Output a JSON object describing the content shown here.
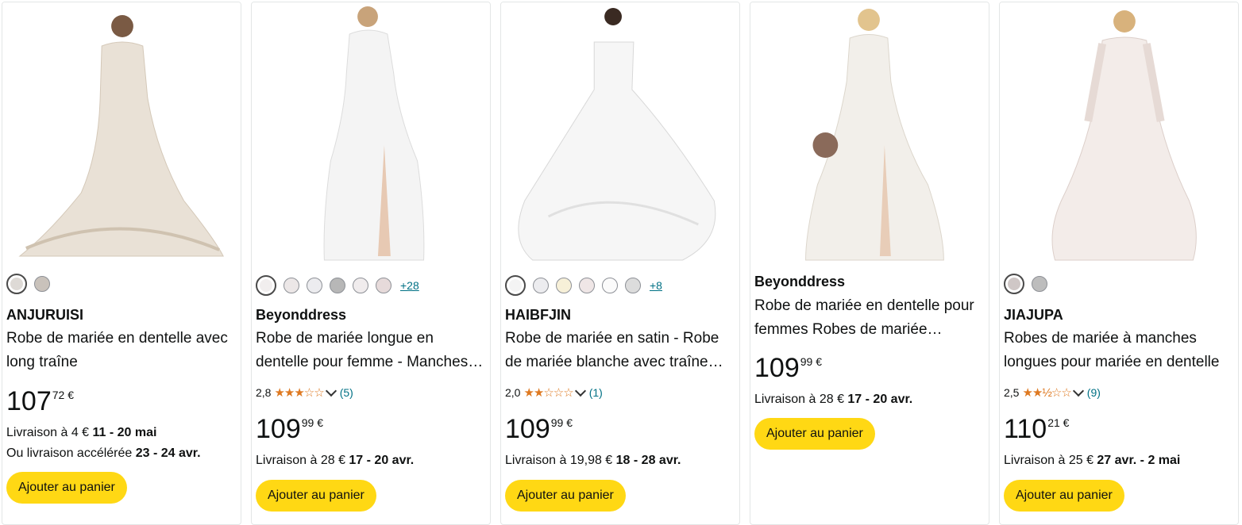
{
  "products": [
    {
      "brand": "ANJURUISI",
      "title": "Robe de mariée en dentelle avec long traîne",
      "price_whole": "107",
      "price_frac": "72 €",
      "delivery_prefix": "Livraison à 4 € ",
      "delivery_date": "11 - 20 mai",
      "delivery2_prefix": "Ou livraison accélérée ",
      "delivery2_date": "23 - 24 avr.",
      "button": "Ajouter au panier",
      "swatch_colors": [
        "#dedad6",
        "#c9c2bb"
      ]
    },
    {
      "brand": "Beyonddress",
      "title": "Robe de mariée longue en dentelle pour femme - Manches courtes",
      "rating_value": "2,8",
      "rating_stars": "★★★☆☆",
      "rating_count": "(5)",
      "price_whole": "109",
      "price_frac": "99 €",
      "delivery_prefix": "Livraison à 28 € ",
      "delivery_date": "17 - 20 avr.",
      "button": "Ajouter au panier",
      "swatch_colors": [
        "#f1eeee",
        "#ece7e7",
        "#ececef",
        "#b7b7b7",
        "#f0eced",
        "#e6dada"
      ],
      "more": "+28"
    },
    {
      "brand": "HAIBFJIN",
      "title": "Robe de mariée en satin - Robe de mariée blanche avec traîne longue",
      "rating_value": "2,0",
      "rating_stars": "★★☆☆☆",
      "rating_count": "(1)",
      "price_whole": "109",
      "price_frac": "99 €",
      "delivery_prefix": "Livraison à 19,98 € ",
      "delivery_date": "18 - 28 avr.",
      "button": "Ajouter au panier",
      "swatch_colors": [
        "#f4f4f4",
        "#ececef",
        "#f7f0d8",
        "#efe6e6",
        "#fbfbfb",
        "#dcdcdc"
      ],
      "more": "+8"
    },
    {
      "brand": "Beyonddress",
      "title": "Robe de mariée en dentelle pour femmes Robes de mariée longues",
      "price_whole": "109",
      "price_frac": "99 €",
      "delivery_prefix": "Livraison à 28 € ",
      "delivery_date": "17 - 20 avr.",
      "button": "Ajouter au panier"
    },
    {
      "brand": "JIAJUPA",
      "title": "Robes de mariée à manches longues pour mariée en dentelle",
      "rating_value": "2,5",
      "rating_stars": "★★½☆☆",
      "rating_count": "(9)",
      "price_whole": "110",
      "price_frac": "21 €",
      "delivery_prefix": "Livraison à 25 € ",
      "delivery_date": "27 avr. - 2 mai",
      "button": "Ajouter au panier",
      "swatch_colors": [
        "#cfc7c6",
        "#bdbdbd"
      ]
    }
  ]
}
